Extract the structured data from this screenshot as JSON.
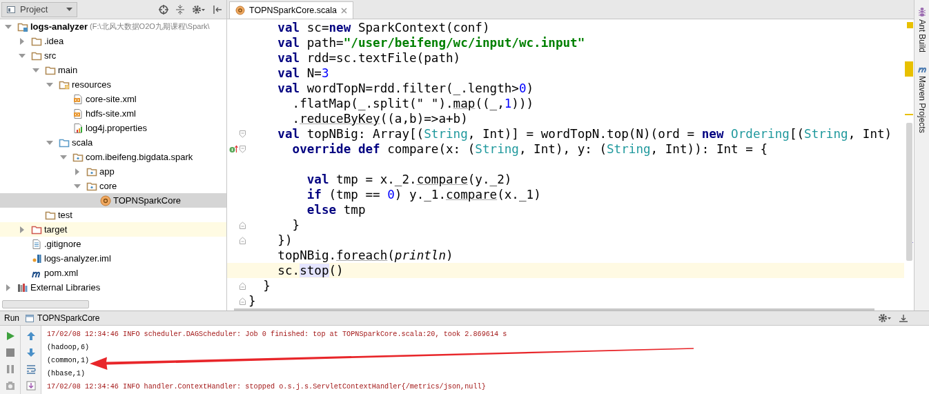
{
  "project_panel": {
    "title": "Project",
    "tree": [
      {
        "label": "logs-analyzer",
        "path": "(F:\\北风大数据O2O九期课程\\Spark\\",
        "kind": "module",
        "expanded": true,
        "selected": false,
        "children": [
          {
            "label": ".idea",
            "kind": "folder",
            "expanded": false,
            "selected": false
          },
          {
            "label": "src",
            "kind": "folder",
            "expanded": true,
            "selected": false,
            "children": [
              {
                "label": "main",
                "kind": "folder",
                "expanded": true,
                "selected": false,
                "children": [
                  {
                    "label": "resources",
                    "kind": "resources",
                    "expanded": true,
                    "selected": false,
                    "children": [
                      {
                        "label": "core-site.xml",
                        "kind": "xml",
                        "selected": false
                      },
                      {
                        "label": "hdfs-site.xml",
                        "kind": "xml",
                        "selected": false
                      },
                      {
                        "label": "log4j.properties",
                        "kind": "properties",
                        "selected": false
                      }
                    ]
                  },
                  {
                    "label": "scala",
                    "kind": "source",
                    "expanded": true,
                    "selected": false,
                    "children": [
                      {
                        "label": "com.ibeifeng.bigdata.spark",
                        "kind": "package",
                        "expanded": true,
                        "selected": false,
                        "children": [
                          {
                            "label": "app",
                            "kind": "package",
                            "expanded": false,
                            "selected": false
                          },
                          {
                            "label": "core",
                            "kind": "package",
                            "expanded": true,
                            "selected": false,
                            "children": [
                              {
                                "label": "TOPNSparkCore",
                                "kind": "scala-object",
                                "selected": true
                              }
                            ]
                          }
                        ]
                      }
                    ]
                  }
                ]
              },
              {
                "label": "test",
                "kind": "folder",
                "selected": false
              }
            ]
          },
          {
            "label": "target",
            "kind": "excluded",
            "expanded": false,
            "selected": false
          },
          {
            "label": ".gitignore",
            "kind": "text",
            "selected": false
          },
          {
            "label": "logs-analyzer.iml",
            "kind": "iml",
            "selected": false
          },
          {
            "label": "pom.xml",
            "kind": "maven",
            "selected": false
          }
        ]
      },
      {
        "label": "External Libraries",
        "kind": "libraries",
        "expanded": false,
        "selected": false
      }
    ]
  },
  "editor": {
    "tabs": [
      {
        "label": "TOPNSparkCore.scala",
        "selected": true
      }
    ],
    "lines": [
      {
        "current": false,
        "tokens": [
          {
            "kind": "kw",
            "text": "    val"
          },
          {
            "kind": "p",
            "text": " sc="
          },
          {
            "kind": "kw",
            "text": "new"
          },
          {
            "kind": "p",
            "text": " SparkContext(conf)"
          }
        ]
      },
      {
        "current": false,
        "tokens": [
          {
            "kind": "kw",
            "text": "    val"
          },
          {
            "kind": "p",
            "text": " path="
          },
          {
            "kind": "s",
            "text": "\"/user/beifeng/wc/input/wc.input\""
          }
        ]
      },
      {
        "current": false,
        "tokens": [
          {
            "kind": "kw",
            "text": "    val"
          },
          {
            "kind": "p",
            "text": " rdd=sc.textFile(path)"
          }
        ]
      },
      {
        "current": false,
        "tokens": [
          {
            "kind": "kw",
            "text": "    val"
          },
          {
            "kind": "p",
            "text": " N="
          },
          {
            "kind": "n",
            "text": "3"
          }
        ]
      },
      {
        "current": false,
        "tokens": [
          {
            "kind": "kw",
            "text": "    val"
          },
          {
            "kind": "p",
            "text": " wordTopN=rdd.filter(_.length>"
          },
          {
            "kind": "n",
            "text": "0"
          },
          {
            "kind": "p",
            "text": ")"
          }
        ]
      },
      {
        "current": false,
        "tokens": [
          {
            "kind": "p",
            "text": "      .flatMap(_.split(\" \")."
          },
          {
            "kind": "u",
            "text": "map"
          },
          {
            "kind": "p",
            "text": "((_,"
          },
          {
            "kind": "n",
            "text": "1"
          },
          {
            "kind": "p",
            "text": ")))"
          }
        ]
      },
      {
        "current": false,
        "tokens": [
          {
            "kind": "p",
            "text": "      ."
          },
          {
            "kind": "u",
            "text": "reduceByKey"
          },
          {
            "kind": "p",
            "text": "((a,b)=>a+b)"
          }
        ]
      },
      {
        "current": false,
        "gutter": [
          {
            "kind": "fold-open"
          }
        ],
        "tokens": [
          {
            "kind": "kw",
            "text": "    val"
          },
          {
            "kind": "p",
            "text": " topNBig: Array[("
          },
          {
            "kind": "ty",
            "text": "String"
          },
          {
            "kind": "p",
            "text": ", Int)] = wordTopN.top(N)(ord = "
          },
          {
            "kind": "kw",
            "text": "new"
          },
          {
            "kind": "ty",
            "text": " Ordering"
          },
          {
            "kind": "p",
            "text": "[("
          },
          {
            "kind": "ty",
            "text": "String"
          },
          {
            "kind": "p",
            "text": ", Int)"
          }
        ]
      },
      {
        "current": false,
        "gutter": [
          {
            "kind": "override"
          },
          {
            "kind": "fold-open"
          }
        ],
        "tokens": [
          {
            "kind": "kw",
            "text": "      override def"
          },
          {
            "kind": "p",
            "text": " compare(x: ("
          },
          {
            "kind": "ty",
            "text": "String"
          },
          {
            "kind": "p",
            "text": ", Int), y: ("
          },
          {
            "kind": "ty",
            "text": "String"
          },
          {
            "kind": "p",
            "text": ", Int)): Int = {"
          }
        ]
      },
      {
        "current": false
      },
      {
        "current": false,
        "tokens": [
          {
            "kind": "kw",
            "text": "        val"
          },
          {
            "kind": "p",
            "text": " tmp = x._2."
          },
          {
            "kind": "u",
            "text": "compare"
          },
          {
            "kind": "p",
            "text": "(y._2)"
          }
        ]
      },
      {
        "current": false,
        "tokens": [
          {
            "kind": "kw",
            "text": "        if"
          },
          {
            "kind": "p",
            "text": " (tmp == "
          },
          {
            "kind": "n",
            "text": "0"
          },
          {
            "kind": "p",
            "text": ") y._1."
          },
          {
            "kind": "u",
            "text": "compare"
          },
          {
            "kind": "p",
            "text": "(x._1)"
          }
        ]
      },
      {
        "current": false,
        "tokens": [
          {
            "kind": "kw",
            "text": "        else"
          },
          {
            "kind": "p",
            "text": " tmp"
          }
        ]
      },
      {
        "current": false,
        "gutter": [
          {
            "kind": "fold-close"
          }
        ],
        "tokens": [
          {
            "kind": "p",
            "text": "      }"
          }
        ]
      },
      {
        "current": false,
        "gutter": [
          {
            "kind": "fold-close"
          }
        ],
        "tokens": [
          {
            "kind": "p",
            "text": "    })"
          }
        ]
      },
      {
        "current": false,
        "tokens": [
          {
            "kind": "p",
            "text": "    topNBig."
          },
          {
            "kind": "u",
            "text": "foreach"
          },
          {
            "kind": "p",
            "text": "("
          },
          {
            "kind": "i",
            "text": "println"
          },
          {
            "kind": "p",
            "text": ")"
          }
        ]
      },
      {
        "current": true,
        "tokens": [
          {
            "kind": "p",
            "text": "    sc."
          },
          {
            "kind": "h",
            "text": "stop"
          },
          {
            "kind": "p",
            "text": "()"
          }
        ]
      },
      {
        "current": false,
        "gutter": [
          {
            "kind": "fold-close"
          }
        ],
        "tokens": [
          {
            "kind": "p",
            "text": "  }"
          }
        ]
      },
      {
        "current": false,
        "gutter": [
          {
            "kind": "fold-close"
          }
        ],
        "tokens": [
          {
            "kind": "p",
            "text": "}"
          }
        ]
      }
    ]
  },
  "tool_strip": [
    {
      "label": "Ant Build",
      "kind": "ant"
    },
    {
      "label": "Maven Projects",
      "kind": "maven"
    }
  ],
  "run_panel": {
    "title": "Run",
    "config": "TOPNSparkCore",
    "console": [
      {
        "kind": "log",
        "text": "17/02/08 12:34:46 INFO scheduler.DAGScheduler: Job 0 finished: top at TOPNSparkCore.scala:20, took 2.869614 s"
      },
      {
        "kind": "output",
        "text": "(hadoop,6)"
      },
      {
        "kind": "output",
        "text": "(common,1)"
      },
      {
        "kind": "output",
        "text": "(hbase,1)"
      },
      {
        "kind": "log",
        "text": "17/02/08 12:34:46 INFO handler.ContextHandler: stopped o.s.j.s.ServletContextHandler{/metrics/json,null}"
      }
    ]
  }
}
